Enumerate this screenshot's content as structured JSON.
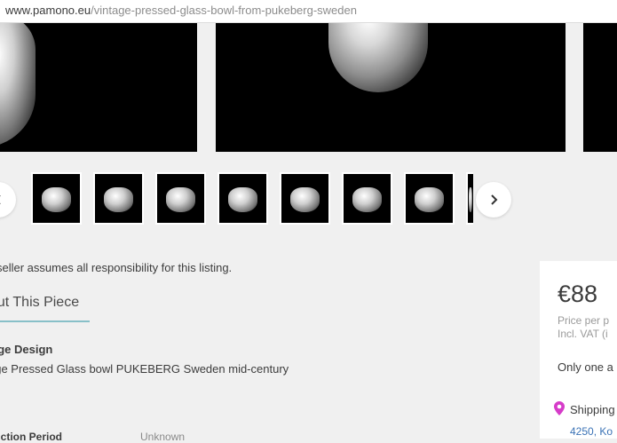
{
  "browser": {
    "url_domain": "www.pamono.eu",
    "url_path": "/vintage-pressed-glass-bowl-from-pukeberg-sweden"
  },
  "gallery": {
    "prev_icon": "chevron-left-icon",
    "next_icon": "chevron-right-icon",
    "thumbnail_count": 7
  },
  "listing": {
    "seller_note": "seller assumes all responsibility for this listing.",
    "about_title": "out This Piece",
    "design_label": "age Design",
    "design_description": "age Pressed Glass bowl PUKEBERG Sweden mid-century",
    "production_label": "duction Period",
    "production_value": "Unknown"
  },
  "purchase": {
    "price": "€88",
    "price_per": "Price per p",
    "vat": "Incl. VAT (i",
    "availability": "Only one a",
    "shipping_label": "Shipping",
    "shipping_address": "4250, Ko"
  },
  "colors": {
    "accent_underline": "#88c0c8",
    "pin": "#d63cc9",
    "link": "#3a72b5"
  }
}
